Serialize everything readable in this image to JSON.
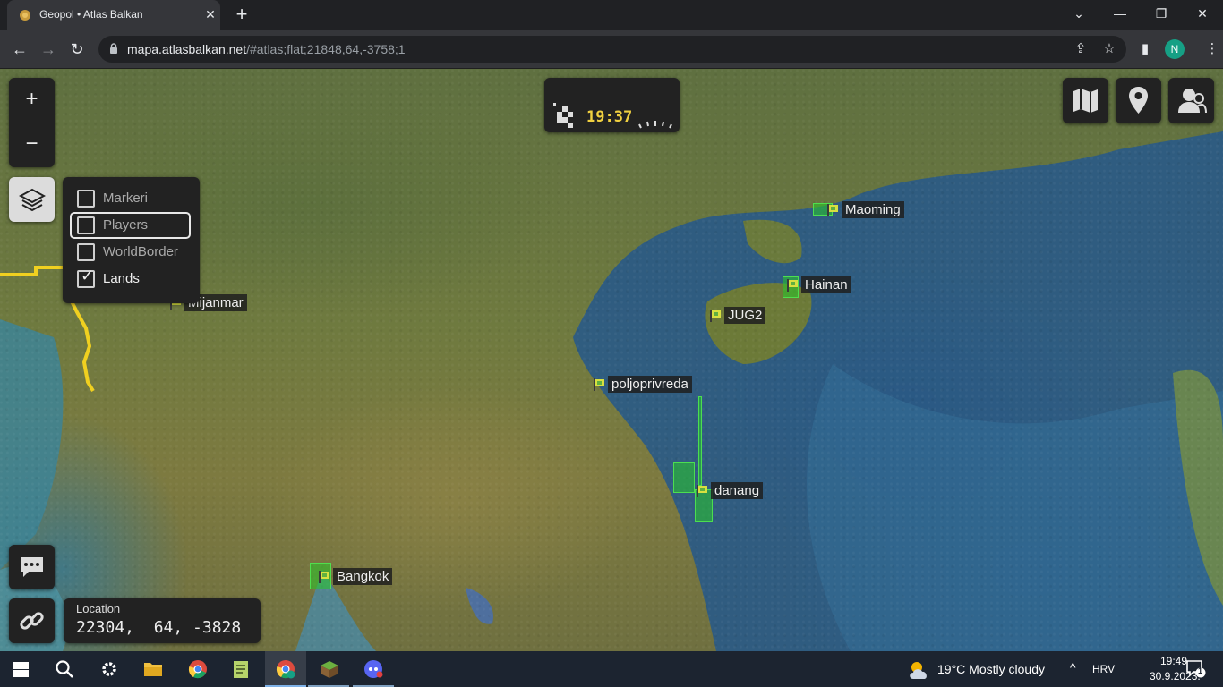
{
  "browser": {
    "tab_title": "Geopol • Atlas Balkan",
    "url_host": "mapa.atlasbalkan.net",
    "url_path": "/#atlas;flat;21848,64,-3758;1",
    "profile_initial": "N"
  },
  "map": {
    "layers": [
      {
        "label": "Markeri",
        "checked": false
      },
      {
        "label": "Players",
        "checked": false
      },
      {
        "label": "WorldBorder",
        "checked": false
      },
      {
        "label": "Lands",
        "checked": true
      }
    ],
    "clock_time": "19:37",
    "location_label": "Location",
    "location_value": "22304,  64, -3828",
    "zoom_in": "+",
    "zoom_out": "−",
    "markers": [
      "Maoming",
      "Hainan",
      "JUG2",
      "Mijanmar",
      "poljoprivreda",
      "danang",
      "Bangkok"
    ],
    "accent_border": "#f0d020"
  },
  "taskbar": {
    "weather": "19°C  Mostly cloudy",
    "language": "HRV",
    "time": "19:49",
    "date": "30.9.2023.",
    "notification_count": "1"
  }
}
